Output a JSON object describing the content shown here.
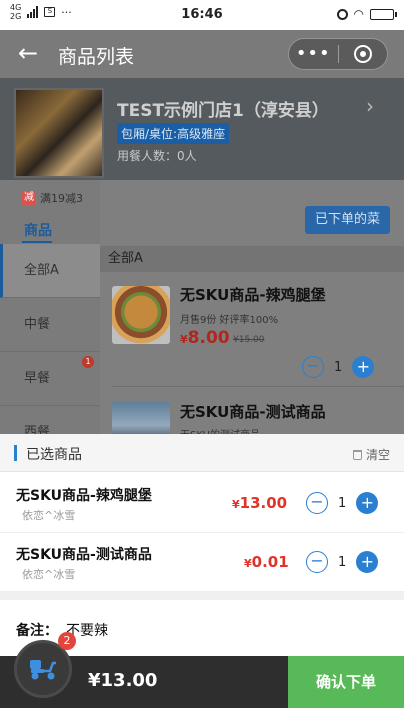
{
  "status_bar": {
    "network_top": "4G",
    "network_bottom": "2G",
    "sim_icon": "sim-card-icon",
    "more": "···",
    "time": "16:46"
  },
  "nav": {
    "title": "商品列表",
    "back_icon": "back-arrow-icon",
    "menu_icon": "more-dots-icon",
    "menu_glyph": "•••",
    "close_icon": "record-close-icon"
  },
  "store": {
    "name": "TEST示例门店1（淳安县）",
    "arrow": "›",
    "seat_tag": "包厢/桌位:高级雅座",
    "diners": "用餐人数：0人"
  },
  "promo": {
    "badge": "减",
    "text": "满19减3"
  },
  "tabs": {
    "goods": "商品",
    "ordered_button": "已下单的菜"
  },
  "categories": [
    {
      "label": "全部A",
      "active": true
    },
    {
      "label": "中餐",
      "active": false
    },
    {
      "label": "早餐",
      "active": false,
      "badge": "1"
    },
    {
      "label": "西餐",
      "active": false
    }
  ],
  "section_title": "全部A",
  "products": [
    {
      "name": "无SKU商品-辣鸡腿堡",
      "sub": "月售9份 好评率100%",
      "price_symbol": "¥",
      "price": "8.00",
      "old_price": "¥15.00",
      "qty": "1"
    },
    {
      "name": "无SKU商品-测试商品",
      "sub": "无SKU的测试商品"
    }
  ],
  "cart": {
    "title": "已选商品",
    "clear": "清空",
    "items": [
      {
        "name": "无SKU商品-辣鸡腿堡",
        "user": "依恋^冰雪",
        "price_symbol": "¥",
        "price": "13.00",
        "qty": "1"
      },
      {
        "name": "无SKU商品-测试商品",
        "user": "依恋^冰雪",
        "price_symbol": "¥",
        "price": "0.01",
        "qty": "1"
      }
    ],
    "remark_label": "备注：",
    "remark_value": "不要辣"
  },
  "bottom": {
    "cart_count": "2",
    "total": "¥13.00",
    "confirm": "确认下单"
  },
  "colors": {
    "accent": "#2b7fd0",
    "price": "#e0342a",
    "confirm": "#57b957"
  }
}
